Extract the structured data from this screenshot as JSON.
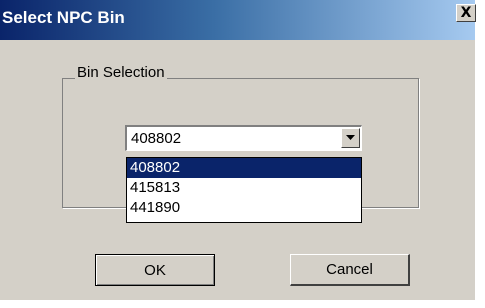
{
  "window": {
    "title": "Select NPC Bin",
    "close_label": "X"
  },
  "group": {
    "label": "Bin Selection"
  },
  "combo": {
    "selected_value": "408802",
    "arrow_icon": "chevron-down-icon"
  },
  "dropdown": {
    "items": [
      {
        "label": "408802",
        "selected": true
      },
      {
        "label": "415813",
        "selected": false
      },
      {
        "label": "441890",
        "selected": false
      }
    ]
  },
  "buttons": {
    "ok_label": "OK",
    "cancel_label": "Cancel"
  },
  "colors": {
    "title_bar_start": "#0a246a",
    "title_bar_end": "#a6caf0",
    "dialog_bg": "#d4d0c8",
    "selection_bg": "#0a246a"
  }
}
